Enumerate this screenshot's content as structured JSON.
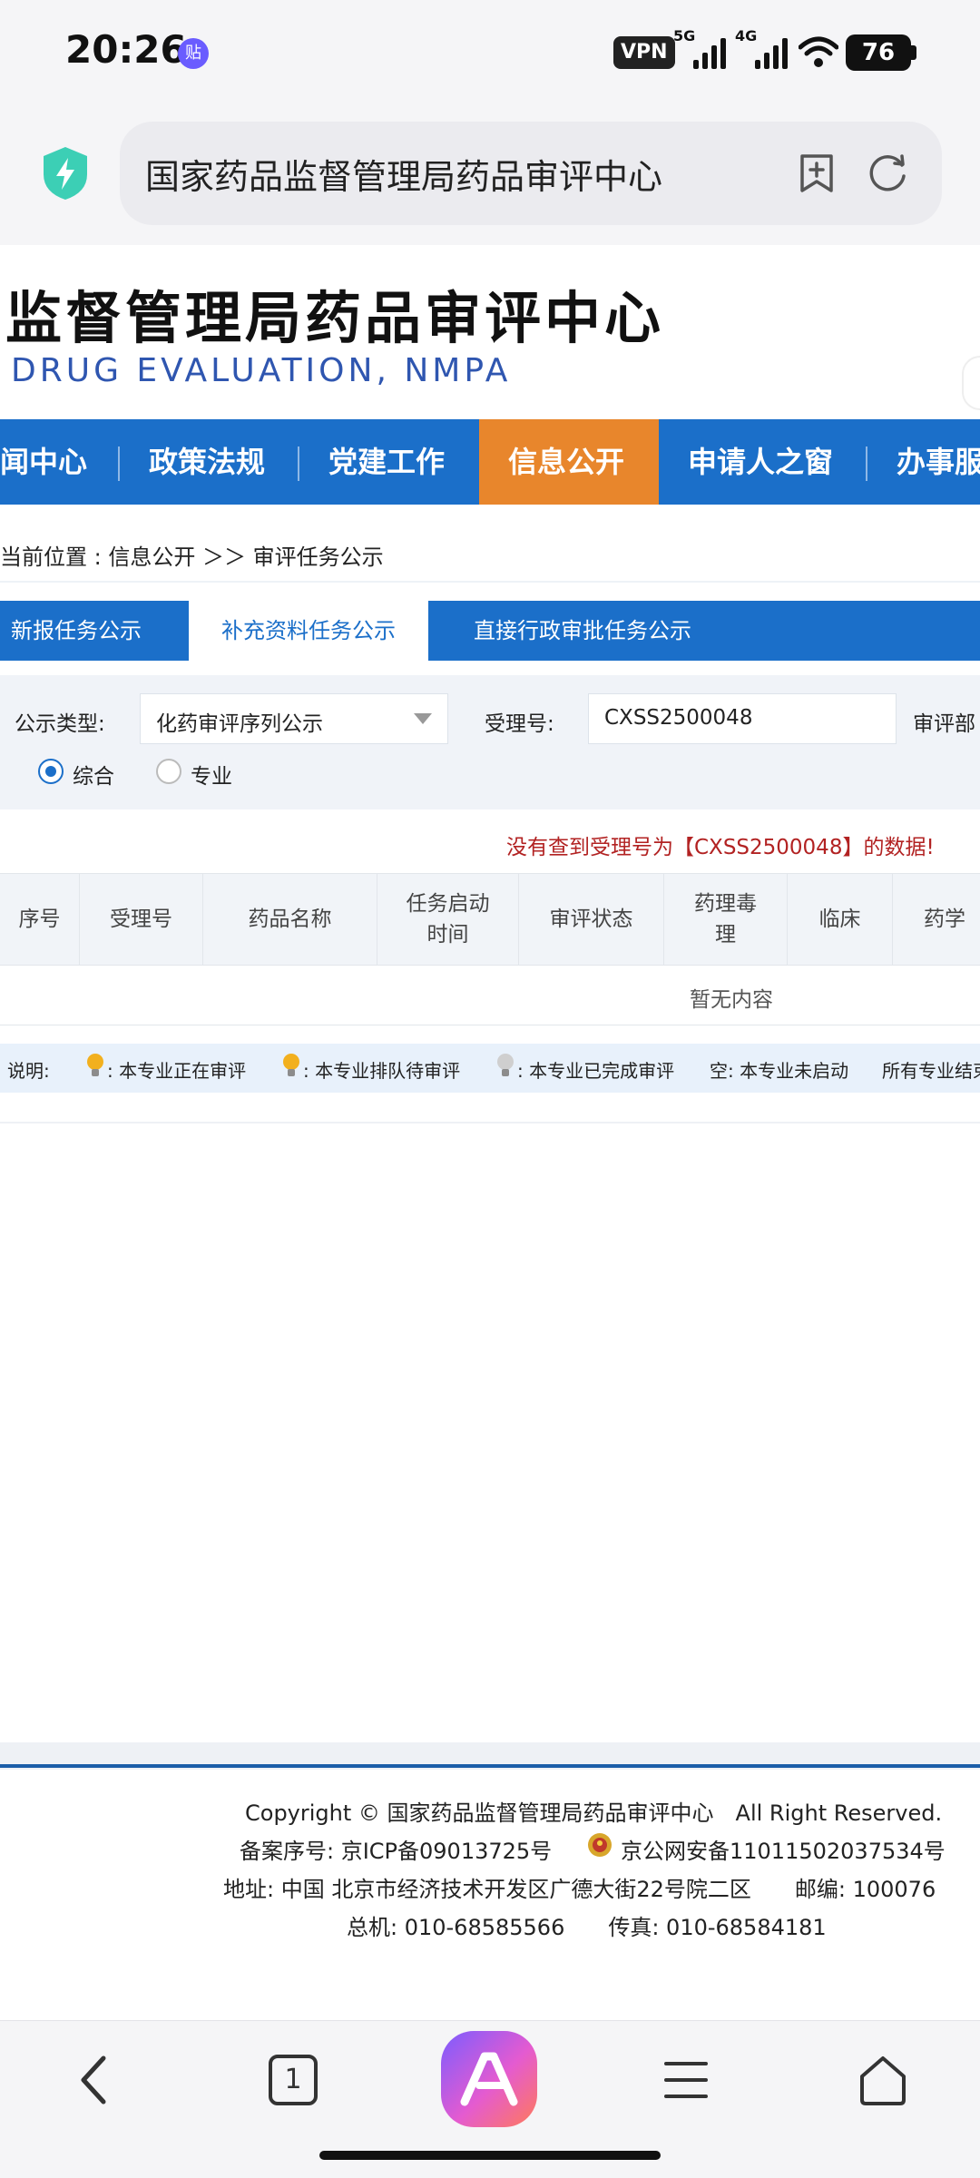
{
  "status_bar": {
    "time": "20:26",
    "notif_badge": "贴",
    "vpn": "VPN",
    "net1": "5G",
    "net2": "4G",
    "battery": "76"
  },
  "browser": {
    "url_text": "国家药品监督管理局药品审评中心",
    "icons": [
      "shield-lightning-icon",
      "bookmark-add-icon",
      "reload-icon"
    ]
  },
  "site": {
    "title": "监督管理局药品审评中心",
    "subtitle": "DRUG EVALUATION, NMPA"
  },
  "nav": {
    "items": [
      "闻中心",
      "政策法规",
      "党建工作",
      "信息公开",
      "申请人之窗",
      "办事服"
    ],
    "active_index": 3
  },
  "breadcrumb": {
    "label": "当前位置 : ",
    "path": "信息公开 ＞＞ 审评任务公示"
  },
  "tabs": [
    "新报任务公示",
    "补充资料任务公示",
    "直接行政审批任务公示"
  ],
  "filter": {
    "type_label": "公示类型:",
    "type_value": "化药审评序列公示",
    "accept_label": "受理号:",
    "accept_value": "CXSS2500048",
    "dept_label": "审评部",
    "radio_options": [
      "综合",
      "专业"
    ],
    "radio_selected": 0
  },
  "message": "没有查到受理号为【CXSS2500048】的数据!",
  "table": {
    "headers": [
      "序号",
      "受理号",
      "药品名称",
      "任务启动时间",
      "审评状态",
      "药理毒理",
      "临床",
      "药学"
    ],
    "header_lines": [
      [
        "序号"
      ],
      [
        "受理号"
      ],
      [
        "药品名称"
      ],
      [
        "任务启动",
        "时间"
      ],
      [
        "审评状态"
      ],
      [
        "药理毒",
        "理"
      ],
      [
        "临床"
      ],
      [
        "药学"
      ]
    ],
    "empty_text": "暂无内容"
  },
  "legend": {
    "lead": "说明:",
    "items": [
      ": 本专业正在审评",
      ": 本专业排队待审评",
      ": 本专业已完成审评",
      "空: 本专业未启动",
      "所有专业结束"
    ],
    "bulb_colors": [
      "#f2b01e",
      "#f2b01e",
      "#cfcfcf"
    ]
  },
  "footer": {
    "copyright": "Copyright © 国家药品监督管理局药品审评中心　All Right Reserved.",
    "icp": "备案序号: 京ICP备09013725号",
    "police": "京公网安备11011502037534号",
    "address": "地址: 中国 北京市经济技术开发区广德大街22号院二区　　邮编: 100076",
    "phone": "总机: 010-68585566　　传真: 010-68584181"
  },
  "bottom_nav": {
    "tab_count": "1",
    "icons": [
      "back-icon",
      "tabs-icon",
      "ai-assistant-icon",
      "menu-icon",
      "home-icon"
    ]
  },
  "colors": {
    "nav_blue": "#1b6fc9",
    "nav_active": "#e8862c",
    "error_red": "#b22222",
    "subtitle_blue": "#2f56b0"
  }
}
